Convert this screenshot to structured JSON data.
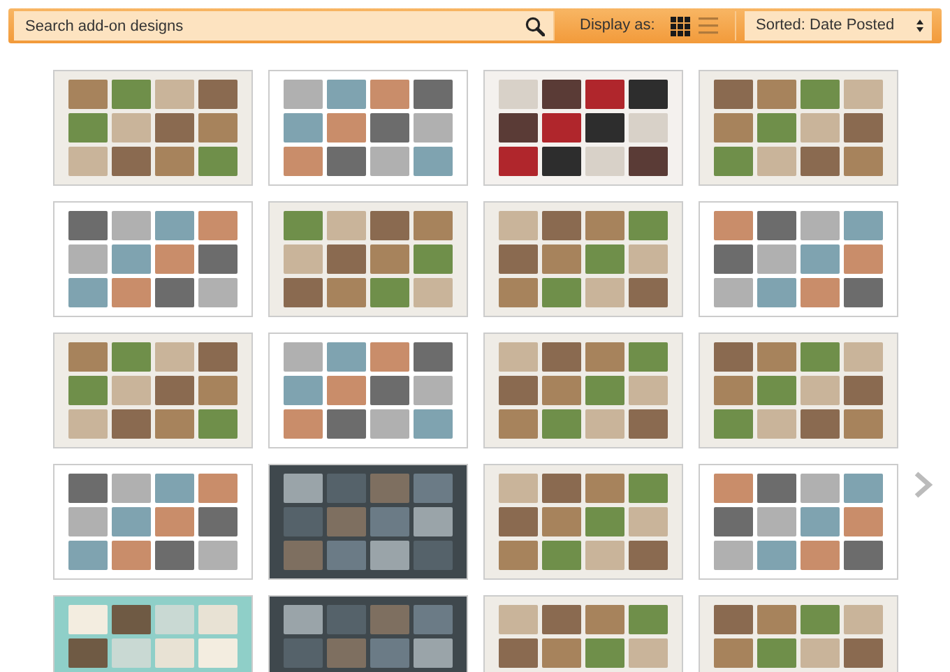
{
  "toolbar": {
    "search": {
      "placeholder": "Search add-on designs"
    },
    "display_label": "Display as:",
    "views": [
      {
        "kind": "grid",
        "selected": true
      },
      {
        "kind": "list",
        "selected": false
      }
    ],
    "sort": {
      "value": "Sorted: Date Posted"
    }
  },
  "designs": [
    {
      "kind": "light"
    },
    {
      "kind": "white"
    },
    {
      "kind": "bold"
    },
    {
      "kind": "light"
    },
    {
      "kind": "white"
    },
    {
      "kind": "light"
    },
    {
      "kind": "light"
    },
    {
      "kind": "white"
    },
    {
      "kind": "light"
    },
    {
      "kind": "white"
    },
    {
      "kind": "light"
    },
    {
      "kind": "light"
    },
    {
      "kind": "white"
    },
    {
      "kind": "dark"
    },
    {
      "kind": "light"
    },
    {
      "kind": "white"
    },
    {
      "kind": "teal"
    },
    {
      "kind": "dark"
    },
    {
      "kind": "light"
    },
    {
      "kind": "light"
    }
  ]
}
